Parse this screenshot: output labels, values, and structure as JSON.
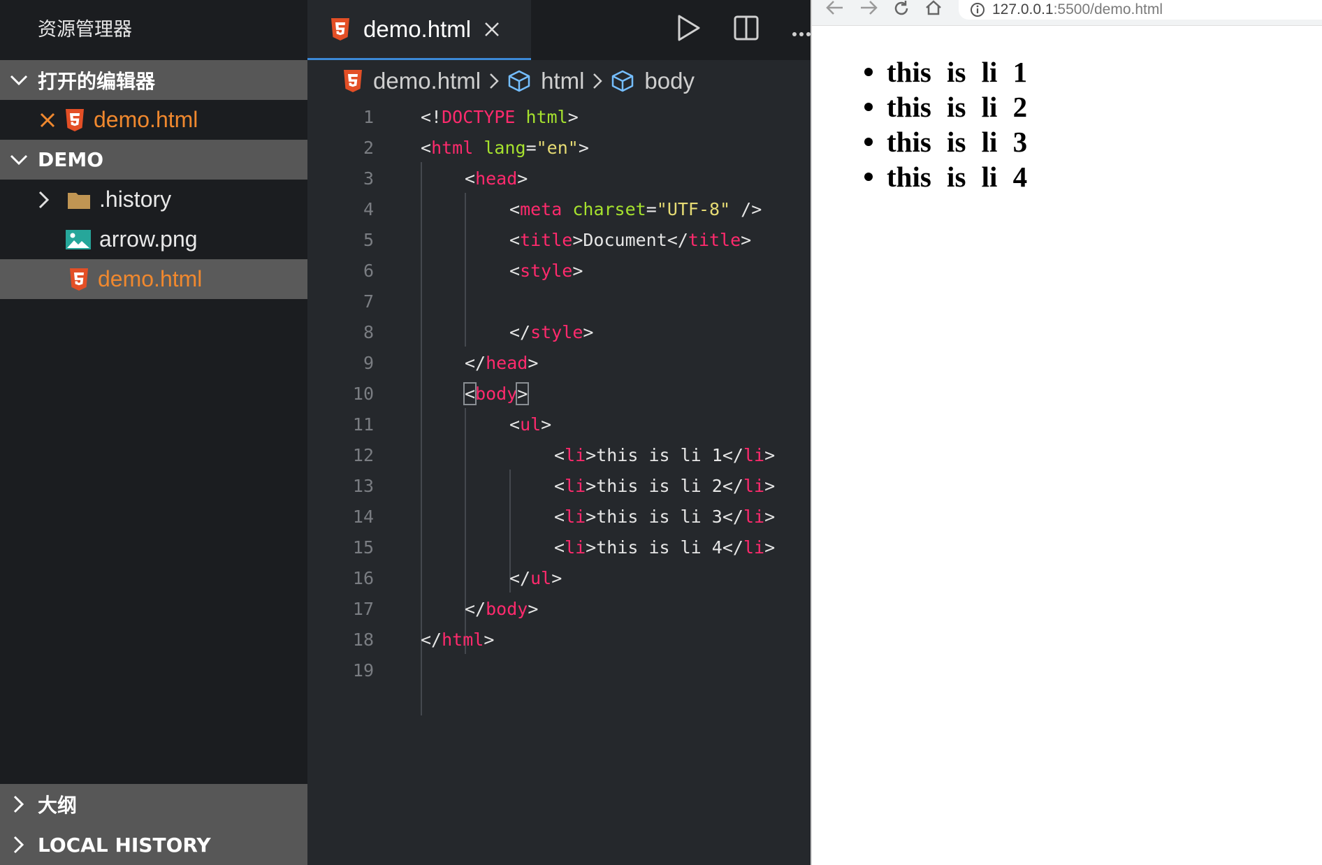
{
  "explorer": {
    "title": "资源管理器",
    "open_editors": {
      "label": "打开的编辑器",
      "items": [
        {
          "name": "demo.html"
        }
      ]
    },
    "folder": {
      "label": "DEMO",
      "items": [
        {
          "name": ".history",
          "kind": "folder"
        },
        {
          "name": "arrow.png",
          "kind": "image"
        },
        {
          "name": "demo.html",
          "kind": "html"
        }
      ]
    },
    "outline_label": "大纲",
    "local_history_label": "LOCAL HISTORY"
  },
  "editor": {
    "tab_label": "demo.html",
    "breadcrumb": [
      "demo.html",
      "html",
      "body"
    ],
    "line_numbers": [
      "1",
      "2",
      "3",
      "4",
      "5",
      "6",
      "7",
      "8",
      "9",
      "10",
      "11",
      "12",
      "13",
      "14",
      "15",
      "16",
      "17",
      "18",
      "19"
    ],
    "code": {
      "l1": {
        "a": "<!",
        "b": "DOCTYPE",
        "c": " ",
        "d": "html",
        "e": ">"
      },
      "l2": {
        "a": "<",
        "b": "html",
        "c": " ",
        "d": "lang",
        "e": "=",
        "f": "\"en\"",
        "g": ">"
      },
      "l3": {
        "a": "<",
        "b": "head",
        "c": ">"
      },
      "l4": {
        "a": "<",
        "b": "meta",
        "c": " ",
        "d": "charset",
        "e": "=",
        "f": "\"UTF-8\"",
        "g": " />"
      },
      "l5": {
        "a": "<",
        "b": "title",
        "c": ">Document</",
        "d": "title",
        "e": ">"
      },
      "l6": {
        "a": "<",
        "b": "style",
        "c": ">"
      },
      "l8": {
        "a": "</",
        "b": "style",
        "c": ">"
      },
      "l9": {
        "a": "</",
        "b": "head",
        "c": ">"
      },
      "l10": {
        "a": "<",
        "b": "body",
        "c": ">"
      },
      "l11": {
        "a": "<",
        "b": "ul",
        "c": ">"
      },
      "li": [
        {
          "a": "<",
          "b": "li",
          "c": ">this is li 1</",
          "d": "li",
          "e": ">"
        },
        {
          "a": "<",
          "b": "li",
          "c": ">this is li 2</",
          "d": "li",
          "e": ">"
        },
        {
          "a": "<",
          "b": "li",
          "c": ">this is li 3</",
          "d": "li",
          "e": ">"
        },
        {
          "a": "<",
          "b": "li",
          "c": ">this is li 4</",
          "d": "li",
          "e": ">"
        }
      ],
      "l16": {
        "a": "</",
        "b": "ul",
        "c": ">"
      },
      "l17": {
        "a": "</",
        "b": "body",
        "c": ">"
      },
      "l18": {
        "a": "</",
        "b": "html",
        "c": ">"
      }
    }
  },
  "browser": {
    "url_host": "127.0.0.1",
    "url_path": ":5500/demo.html",
    "list_items": [
      "this is li 1",
      "this is li 2",
      "this is li 3",
      "this is li 4"
    ]
  },
  "colors": {
    "html_file": "#f0882e",
    "tag": "#ff2a6d",
    "attr": "#a6e22e",
    "string": "#e6db74",
    "tab_accent": "#3c89d6"
  }
}
